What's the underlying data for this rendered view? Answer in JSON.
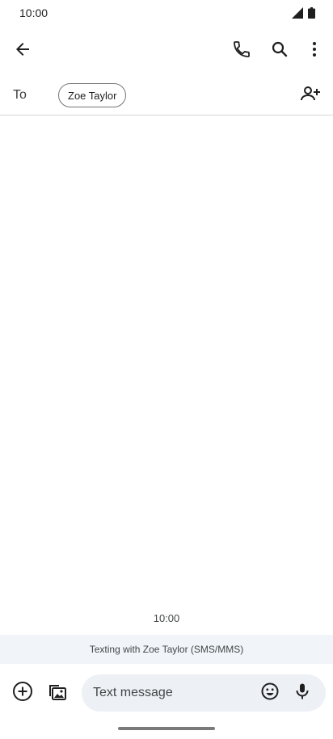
{
  "status_bar": {
    "time": "10:00",
    "icons": [
      "cellular-signal-icon",
      "battery-icon"
    ]
  },
  "app_bar": {
    "icons": [
      "back-arrow-icon",
      "phone-icon",
      "search-icon",
      "more-vert-icon"
    ]
  },
  "recipients": {
    "to_label": "To",
    "chips": [
      "Zoe Taylor"
    ],
    "add_icon": "add-person-icon"
  },
  "conversation": {
    "time": "10:00",
    "texting_info": "Texting with Zoe Taylor (SMS/MMS)"
  },
  "compose": {
    "placeholder": "Text message",
    "value": "",
    "icons": [
      "add-circle-icon",
      "gallery-icon",
      "emoji-icon",
      "mic-icon"
    ]
  },
  "colors": {
    "icon": "#1f1f1f",
    "texting_bar_bg": "#f1f4f9",
    "compose_field_bg": "#edf0f5",
    "chip_border": "#757575"
  }
}
